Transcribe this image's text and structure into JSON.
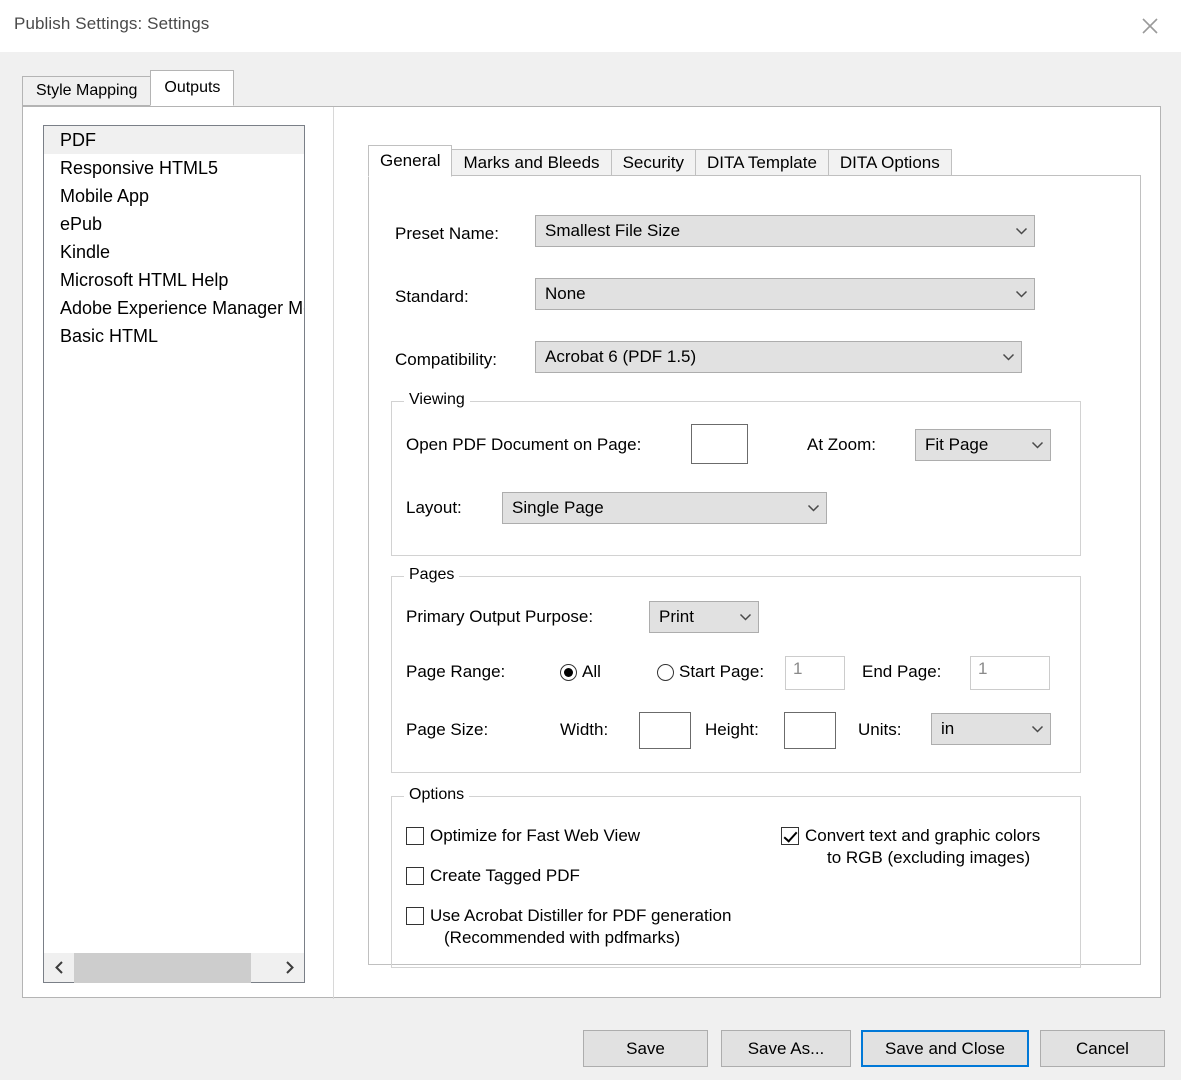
{
  "window": {
    "title": "Publish Settings: Settings",
    "close_icon": "close-icon"
  },
  "outer_tabs": [
    {
      "label": "Style Mapping",
      "active": false
    },
    {
      "label": "Outputs",
      "active": true
    }
  ],
  "output_list": {
    "items": [
      {
        "label": "PDF",
        "selected": true
      },
      {
        "label": "Responsive HTML5",
        "selected": false
      },
      {
        "label": "Mobile App",
        "selected": false
      },
      {
        "label": "ePub",
        "selected": false
      },
      {
        "label": "Kindle",
        "selected": false
      },
      {
        "label": "Microsoft HTML Help",
        "selected": false
      },
      {
        "label": "Adobe Experience Manager Mo",
        "selected": false
      },
      {
        "label": "Basic HTML",
        "selected": false
      }
    ],
    "scroll_left_icon": "chevron-left-icon",
    "scroll_right_icon": "chevron-right-icon"
  },
  "inner_tabs": [
    {
      "label": "General",
      "active": true
    },
    {
      "label": "Marks and Bleeds",
      "active": false
    },
    {
      "label": "Security",
      "active": false
    },
    {
      "label": "DITA Template",
      "active": false
    },
    {
      "label": "DITA Options",
      "active": false
    }
  ],
  "general": {
    "preset_name": {
      "label": "Preset Name:",
      "value": "Smallest File Size"
    },
    "standard": {
      "label": "Standard:",
      "value": "None"
    },
    "compatibility": {
      "label": "Compatibility:",
      "value": "Acrobat 6 (PDF 1.5)"
    },
    "viewing": {
      "legend": "Viewing",
      "open_page": {
        "label": "Open PDF Document on Page:",
        "value": ""
      },
      "at_zoom": {
        "label": "At Zoom:",
        "value": "Fit Page"
      },
      "layout": {
        "label": "Layout:",
        "value": "Single Page"
      }
    },
    "pages": {
      "legend": "Pages",
      "primary_output_purpose": {
        "label": "Primary Output Purpose:",
        "value": "Print"
      },
      "page_range": {
        "label": "Page Range:",
        "all": {
          "label": "All",
          "checked": true
        },
        "start": {
          "label": "Start Page:",
          "checked": false,
          "value": "1"
        },
        "end": {
          "label": "End Page:",
          "value": "1"
        }
      },
      "page_size": {
        "label": "Page Size:",
        "width": {
          "label": "Width:",
          "value": ""
        },
        "height": {
          "label": "Height:",
          "value": ""
        },
        "units": {
          "label": "Units:",
          "value": "in"
        }
      }
    },
    "options": {
      "legend": "Options",
      "optimize_fast_web": {
        "label": "Optimize for Fast Web View",
        "checked": false
      },
      "create_tagged_pdf": {
        "label": "Create Tagged PDF",
        "checked": false
      },
      "use_distiller_line1": {
        "label": "Use Acrobat Distiller for PDF generation",
        "checked": false
      },
      "use_distiller_line2": {
        "label": "(Recommended with pdfmarks)"
      },
      "convert_rgb_line1": {
        "label": "Convert text and graphic colors",
        "checked": true
      },
      "convert_rgb_line2": {
        "label": "to RGB (excluding images)"
      }
    }
  },
  "footer": {
    "save": "Save",
    "save_as": "Save As...",
    "save_and_close": "Save and Close",
    "cancel": "Cancel"
  },
  "colors": {
    "accent": "#0078d7",
    "control_face": "#e1e1e1",
    "selection": "#f0f0f0"
  }
}
